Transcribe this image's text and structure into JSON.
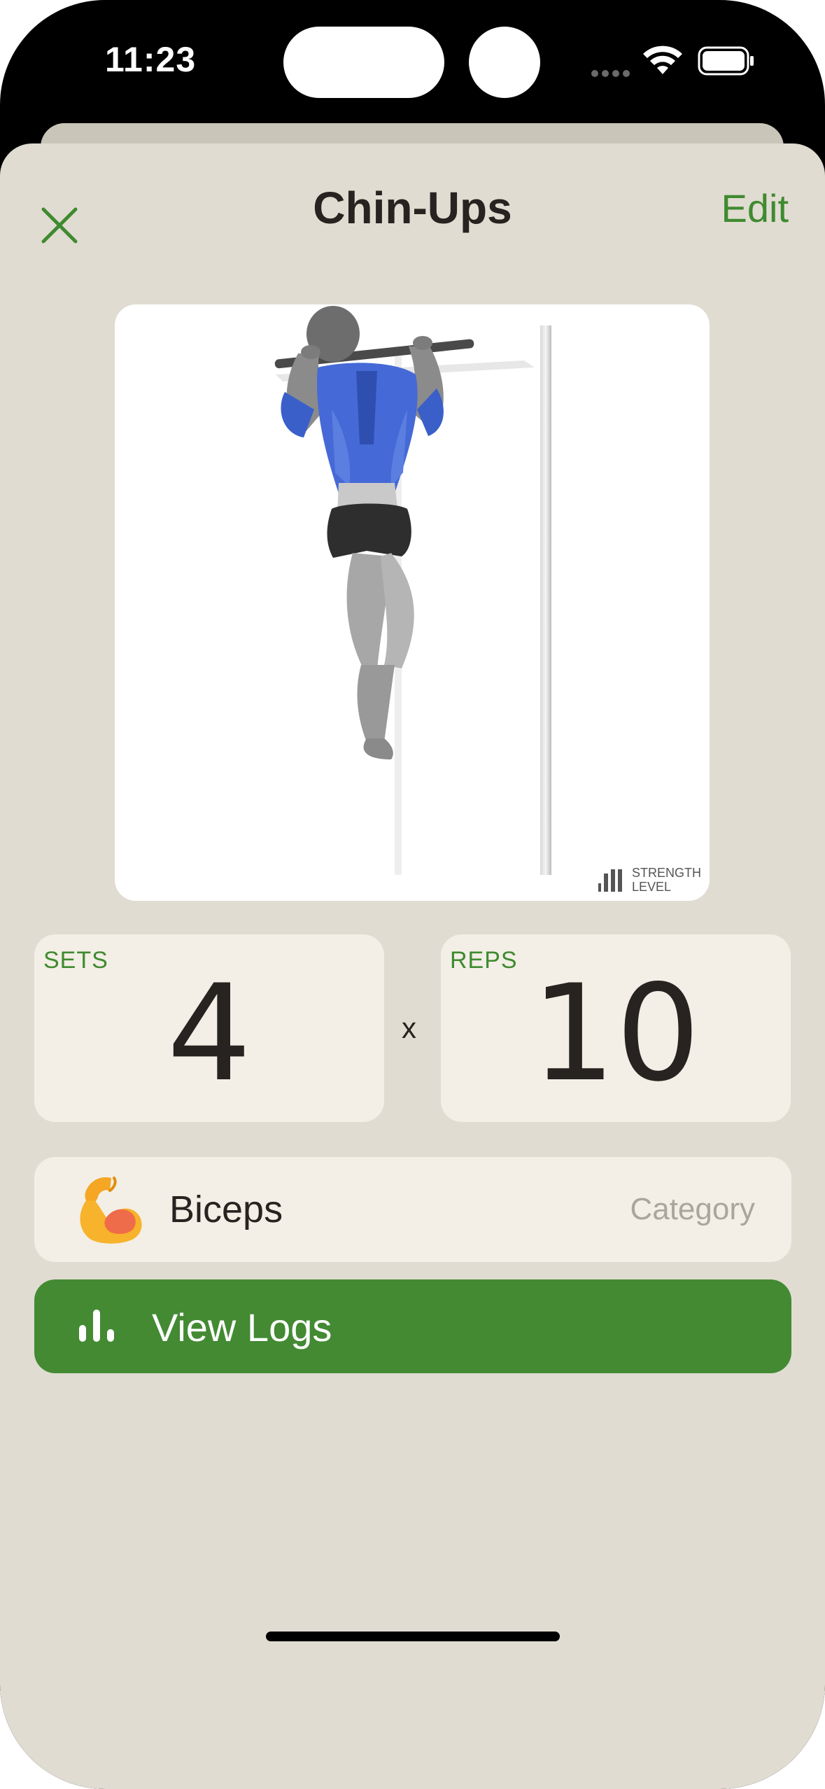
{
  "status_bar": {
    "time": "11:23"
  },
  "header": {
    "title": "Chin-Ups",
    "edit_label": "Edit"
  },
  "image": {
    "watermark": "STRENGTH LEVEL",
    "watermark_line1": "STRENGTH",
    "watermark_line2": "LEVEL"
  },
  "stats": {
    "sets_label": "SETS",
    "sets_value": "4",
    "multiplier": "x",
    "reps_label": "REPS",
    "reps_value": "10"
  },
  "category": {
    "name": "Biceps",
    "hint": "Category",
    "icon": "flexed-biceps-emoji"
  },
  "logs": {
    "label": "View Logs",
    "icon": "bar-chart-icon"
  },
  "colors": {
    "accent": "#438a33",
    "accent_text": "#3f8a30",
    "background": "#e0dcd1",
    "card": "#f3efe6"
  }
}
